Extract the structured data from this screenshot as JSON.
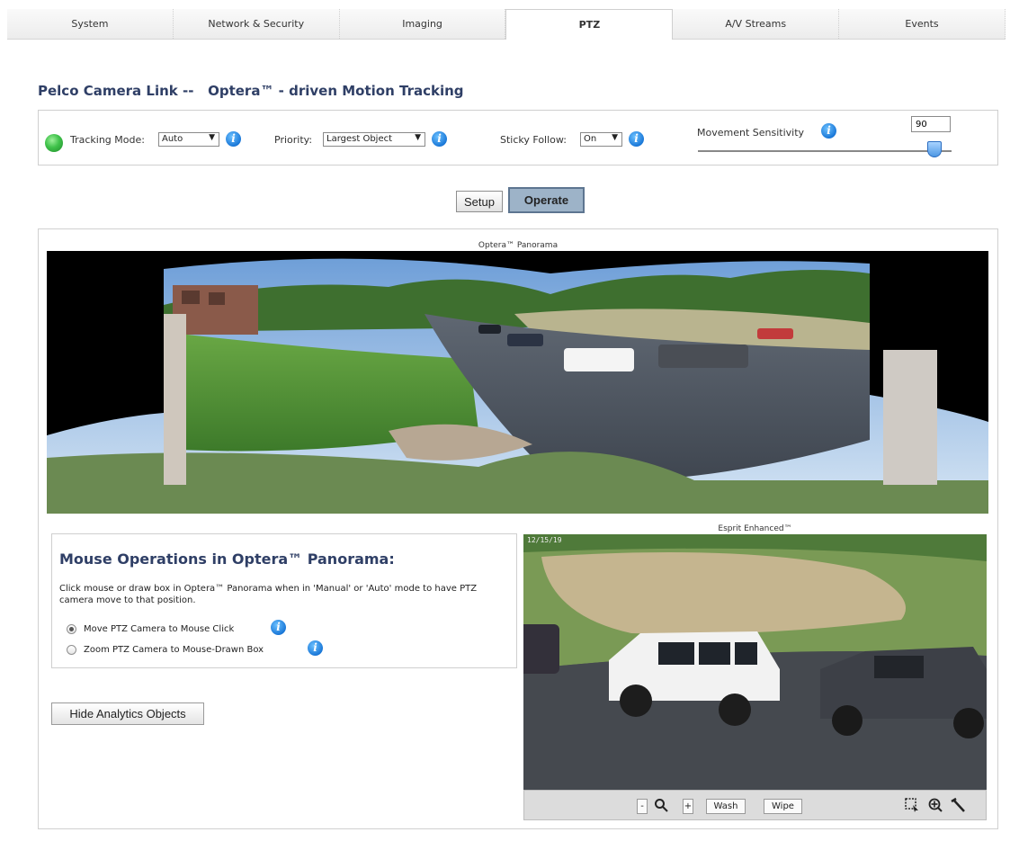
{
  "tabs": [
    {
      "label": "System",
      "active": false
    },
    {
      "label": "Network & Security",
      "active": false
    },
    {
      "label": "Imaging",
      "active": false
    },
    {
      "label": "PTZ",
      "active": true
    },
    {
      "label": "A/V Streams",
      "active": false
    },
    {
      "label": "Events",
      "active": false
    }
  ],
  "page": {
    "title": "Pelco Camera Link --   Optera™ - driven Motion Tracking"
  },
  "controls": {
    "status_color": "#3fc24a",
    "tracking_mode_label": "Tracking Mode:",
    "tracking_mode_value": "Auto",
    "priority_label": "Priority:",
    "priority_value": "Largest Object",
    "sticky_follow_label": "Sticky Follow:",
    "sticky_follow_value": "On",
    "movement_sensitivity_label": "Movement Sensitivity",
    "movement_sensitivity_value": "90",
    "info_glyph": "i"
  },
  "mode_buttons": {
    "setup": "Setup",
    "operate": "Operate",
    "selected": "Operate"
  },
  "panorama": {
    "title": "Optera™ Panorama"
  },
  "esprit": {
    "title": "Esprit Enhanced™",
    "overlay_text": "12/15/19"
  },
  "mouse_ops": {
    "title": "Mouse Operations in Optera™ Panorama:",
    "description": "Click mouse or draw box in Optera™ Panorama when in 'Manual' or 'Auto' mode to have PTZ camera move to that position.",
    "option_move": "Move PTZ Camera to Mouse Click",
    "option_zoom": "Zoom PTZ Camera to Mouse-Drawn Box",
    "selected": "move"
  },
  "hide_button": "Hide Analytics Objects",
  "video_toolbar": {
    "minus": "-",
    "plus": "+",
    "wash": "Wash",
    "wipe": "Wipe",
    "icons": [
      "zoom-minus-icon",
      "magnifier-icon",
      "zoom-plus-icon",
      "box-select-icon",
      "zoom-target-icon",
      "wiper-icon"
    ]
  }
}
